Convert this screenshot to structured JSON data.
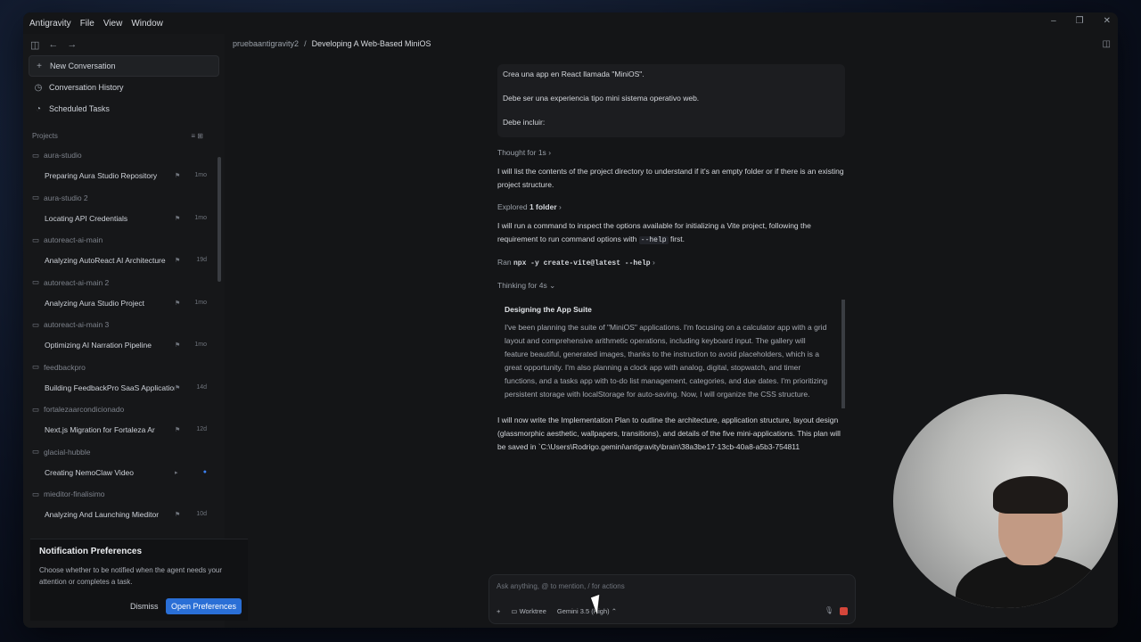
{
  "menubar": {
    "app": "Antigravity",
    "items": [
      "File",
      "View",
      "Window"
    ]
  },
  "window_controls": {
    "minimize": "–",
    "maximize": "❐",
    "close": "✕"
  },
  "sidebar": {
    "nav": [
      {
        "label": "New Conversation",
        "icon": "plus-icon",
        "glyph": "+"
      },
      {
        "label": "Conversation History",
        "icon": "history-icon",
        "glyph": "◷"
      },
      {
        "label": "Scheduled Tasks",
        "icon": "clock-icon",
        "glyph": "◔"
      }
    ],
    "projects_title": "Projects",
    "projects": [
      {
        "name": "aura-studio",
        "conversation": "Preparing Aura Studio Repository",
        "age": "1mo"
      },
      {
        "name": "aura-studio 2",
        "conversation": "Locating API Credentials",
        "age": "1mo"
      },
      {
        "name": "autoreact-ai-main",
        "conversation": "Analyzing AutoReact AI Architecture",
        "age": "19d"
      },
      {
        "name": "autoreact-ai-main 2",
        "conversation": "Analyzing Aura Studio Project",
        "age": "1mo"
      },
      {
        "name": "autoreact-ai-main 3",
        "conversation": "Optimizing AI Narration Pipeline",
        "age": "1mo"
      },
      {
        "name": "feedbackpro",
        "conversation": "Building FeedbackPro SaaS Application",
        "age": "14d"
      },
      {
        "name": "fortalezaarcondicionado",
        "conversation": "Next.js Migration for Fortaleza Ar",
        "age": "12d"
      },
      {
        "name": "glacial-hubble",
        "conversation": "Creating NemoClaw Video",
        "age": "●"
      },
      {
        "name": "mieditor-finalisimo",
        "conversation": "Analyzing And Launching Mieditor",
        "age": "10d"
      }
    ]
  },
  "notification": {
    "title": "Notification Preferences",
    "body": "Choose whether to be notified when the agent needs your attention or completes a task.",
    "dismiss": "Dismiss",
    "open": "Open Preferences"
  },
  "breadcrumb": {
    "project": "pruebaantigravity2",
    "separator": "/",
    "conversation": "Developing A Web-Based MiniOS"
  },
  "chat": {
    "user_lines": [
      "Crea una app en React llamada \"MiniOS\".",
      "Debe ser una experiencia tipo mini sistema operativo web.",
      "Debe incluir:"
    ],
    "thought_label": "Thought for 1s",
    "para1": "I will list the contents of the project directory to understand if it's an empty folder or if there is an existing project structure.",
    "explored_label": "Explored",
    "explored_value": "1 folder",
    "para2_a": "I will run a command to inspect the options available for initializing a Vite project, following the requirement to run command options with",
    "para2_code": "--help",
    "para2_b": "first.",
    "ran_label": "Ran",
    "ran_cmd": "npx -y create-vite@latest --help",
    "thinking_label": "Thinking for 4s",
    "thinking_title": "Designing the App Suite",
    "thinking_body": "I've been planning the suite of \"MiniOS\" applications. I'm focusing on a calculator app with a grid layout and comprehensive arithmetic operations, including keyboard input. The gallery will feature beautiful, generated images, thanks to the instruction to avoid placeholders, which is a great opportunity. I'm also planning a clock app with analog, digital, stopwatch, and timer functions, and a tasks app with to-do list management, categories, and due dates. I'm prioritizing persistent storage with localStorage for auto-saving. Now, I will organize the CSS structure.",
    "para3": "I will now write the Implementation Plan to outline the architecture, application structure, layout design (glassmorphic aesthetic, wallpapers, transitions), and details of the five mini-applications. This plan will be saved in `C:\\Users\\Rodrigo.gemini\\antigravity\\brain\\38a3be17-13cb-40a8-a5b3-754811"
  },
  "composer": {
    "placeholder": "Ask anything, @ to mention, / for actions",
    "add": "+",
    "worktree": "Worktree",
    "model": "Gemini 3.5 (High)"
  }
}
